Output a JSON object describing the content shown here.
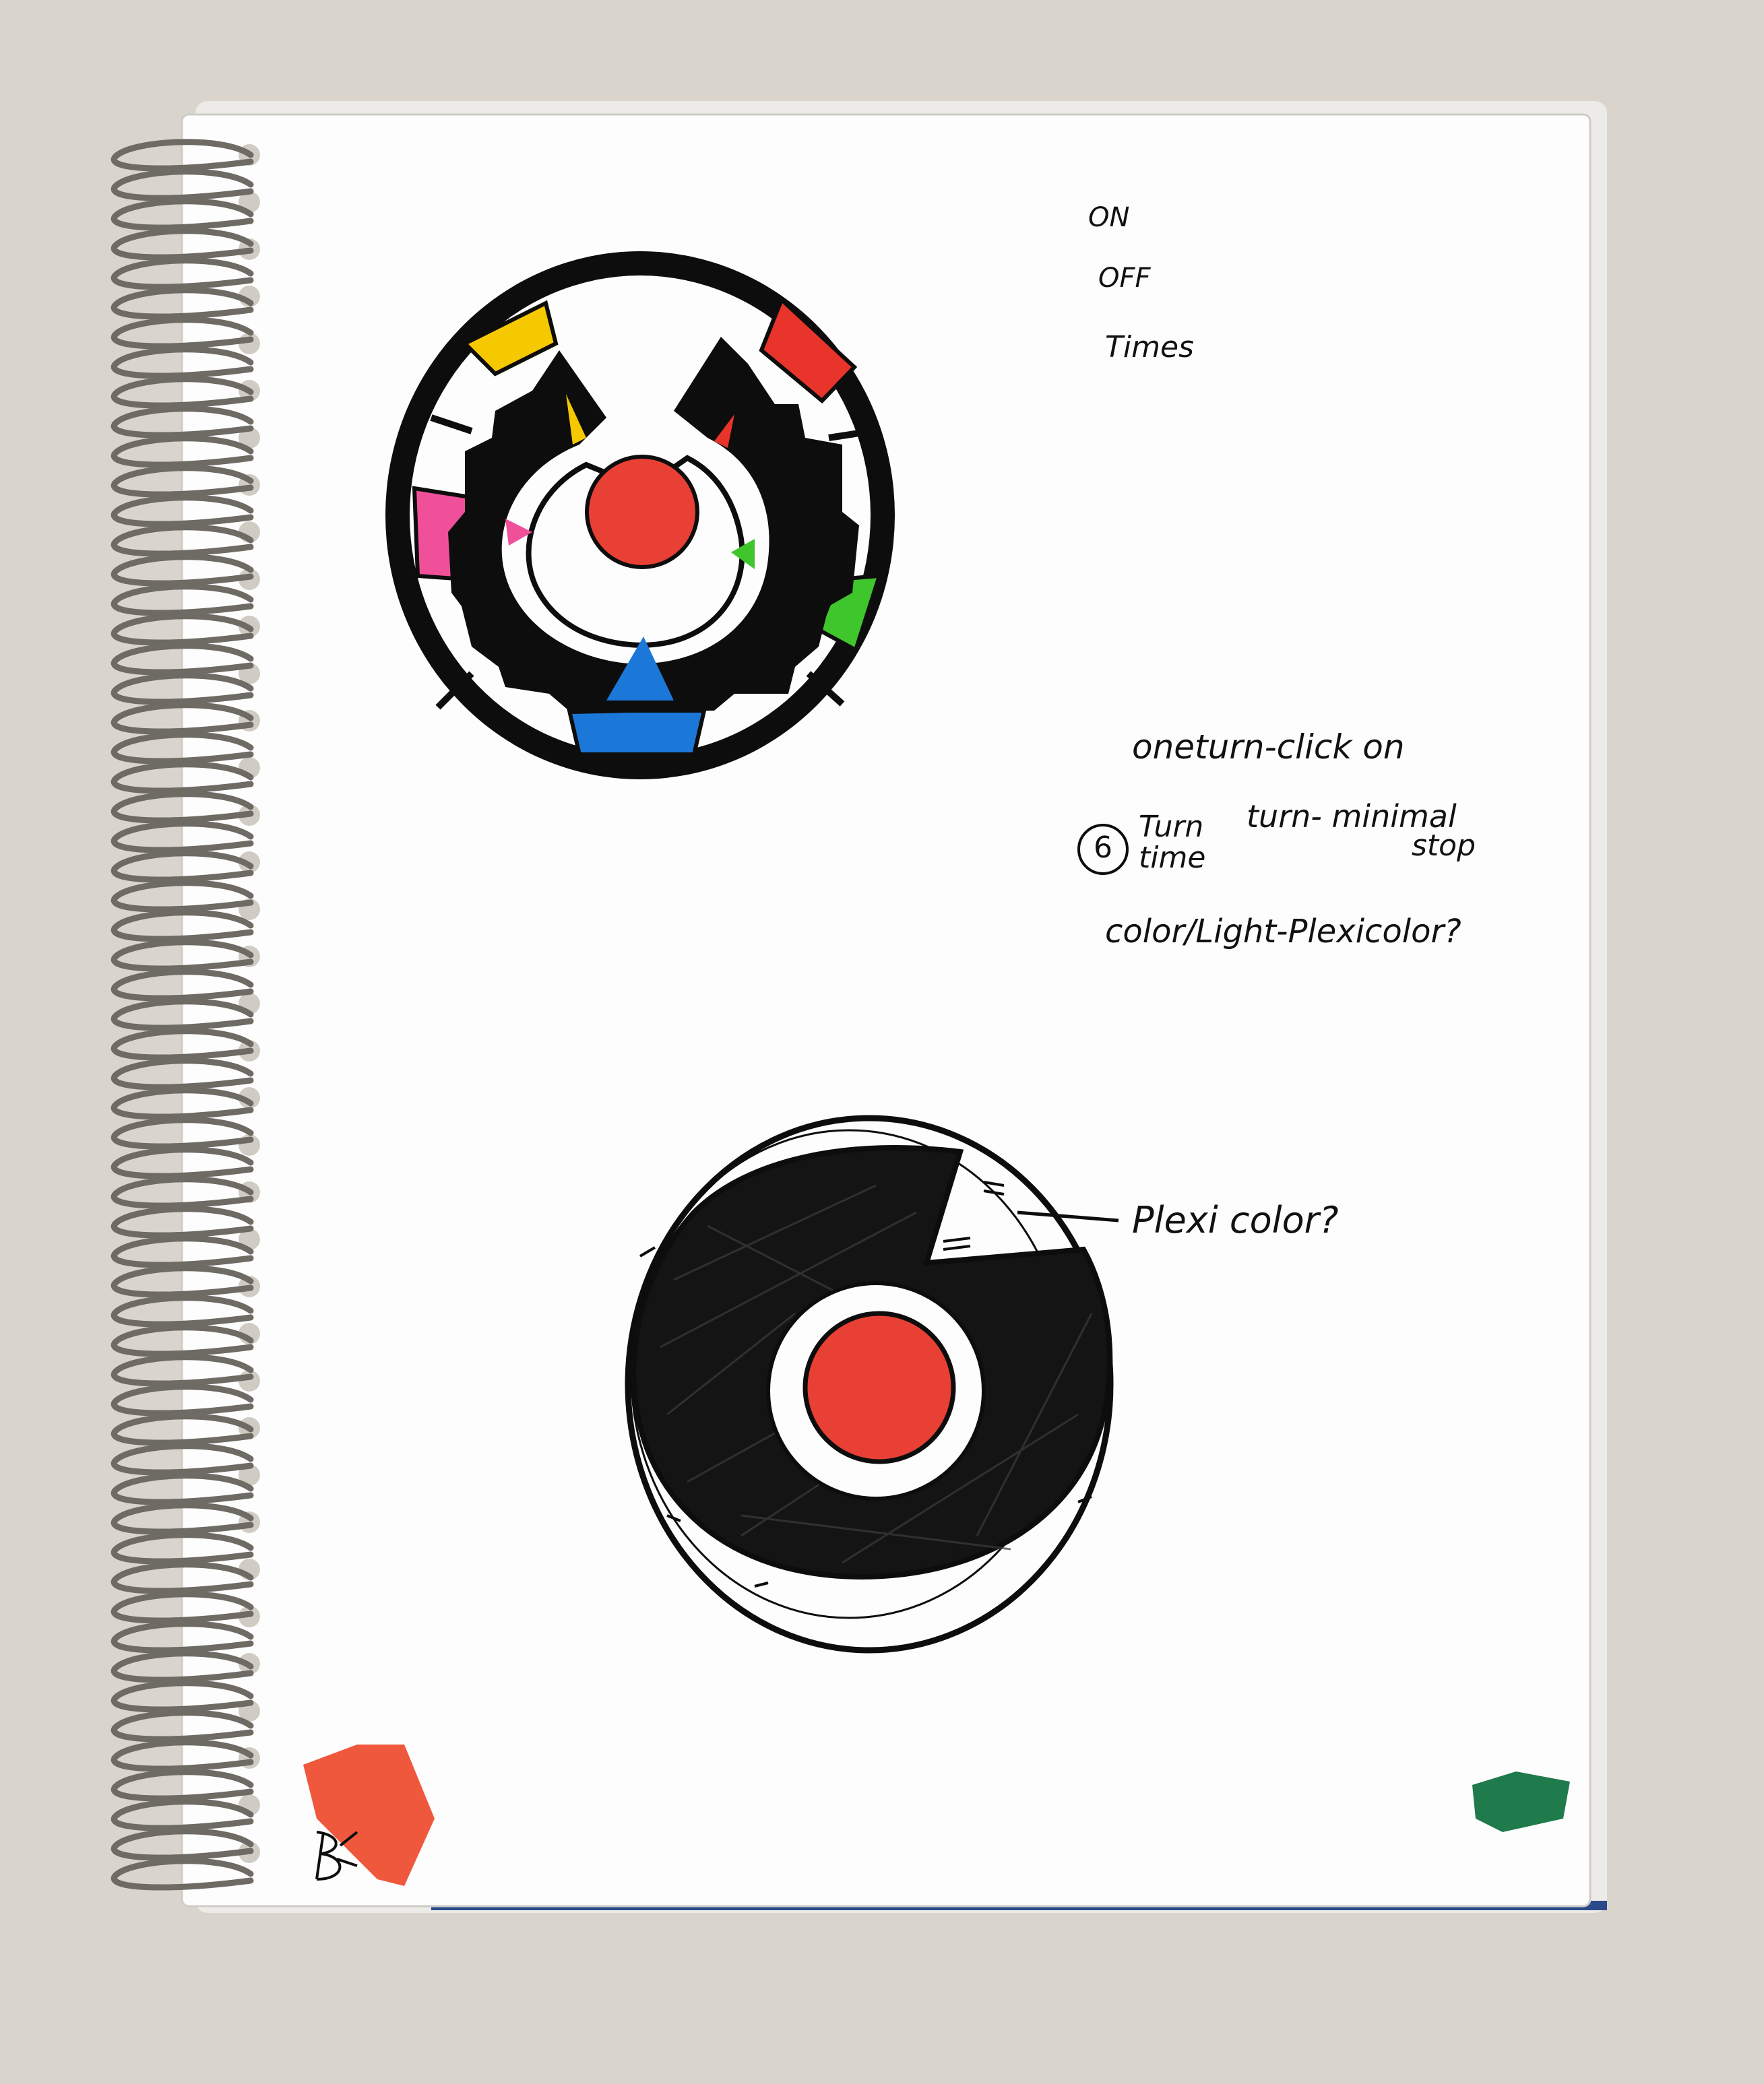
{
  "photo": {
    "background_color": "#d9d4cc",
    "paper_color": "#fdfdfd",
    "ink_color": "#0d0d0d",
    "marker_colors": {
      "yellow": "#f5c800",
      "red": "#e8342a",
      "pink": "#f0509a",
      "green": "#3fc62c",
      "blue": "#1b78d8",
      "center_red": "#e84034",
      "swatch_red": "#ee4a2c",
      "swatch_green": "#1f7a4c"
    }
  },
  "notes": {
    "line_on": "ON",
    "line_off": "OFF",
    "line_times": "Times",
    "oneturn": "oneturn-click on",
    "circled_number": "6",
    "turn_time": "Turn time",
    "turn_minimal": "turn- minimal",
    "stop": "stop",
    "color_light": "color/Light-Plexicolor?",
    "plexi_label": "Plexi color?"
  },
  "signature": "RB"
}
